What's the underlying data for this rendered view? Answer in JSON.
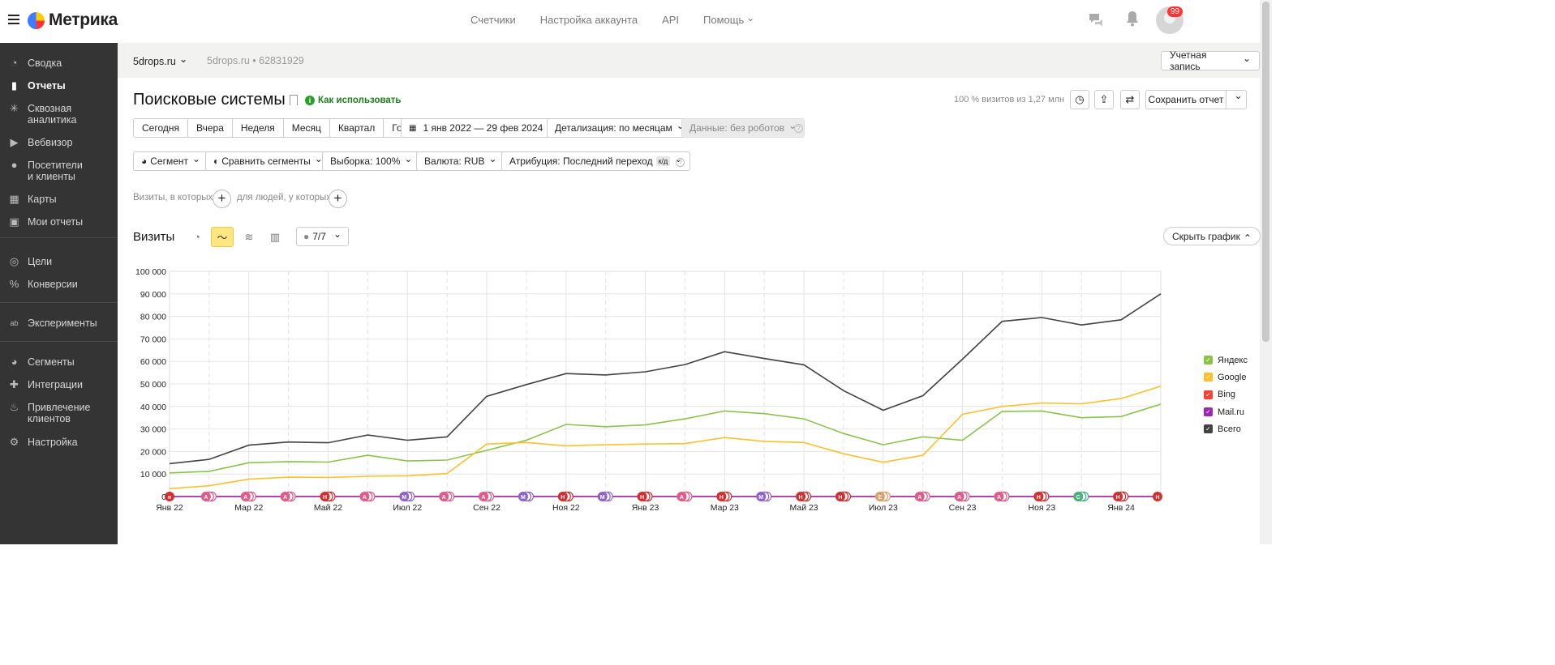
{
  "app": {
    "logo_text": "Метрика",
    "nav": [
      "Счетчики",
      "Настройка аккаунта",
      "API",
      "Помощь"
    ],
    "notifications_badge": "99"
  },
  "sidebar": {
    "items": [
      {
        "label": "Сводка",
        "icon": "gauge-icon"
      },
      {
        "label": "Отчеты",
        "icon": "bar-chart-icon",
        "active": true
      },
      {
        "label": "Сквозная аналитика",
        "icon": "snowflake-icon"
      },
      {
        "label": "Вебвизор",
        "icon": "play-icon"
      },
      {
        "label": "Посетители и клиенты",
        "icon": "user-icon"
      },
      {
        "label": "Карты",
        "icon": "map-icon"
      },
      {
        "label": "Мои отчеты",
        "icon": "inbox-icon"
      },
      {
        "label": "Цели",
        "icon": "target-icon"
      },
      {
        "label": "Конверсии",
        "icon": "percent-icon"
      },
      {
        "label": "Эксперименты",
        "icon": "ab-icon"
      },
      {
        "label": "Сегменты",
        "icon": "pie-icon"
      },
      {
        "label": "Интеграции",
        "icon": "puzzle-icon"
      },
      {
        "label": "Привлечение клиентов",
        "icon": "fire-icon"
      },
      {
        "label": "Настройка",
        "icon": "gear-icon"
      }
    ]
  },
  "subheader": {
    "counter": "5drops.ru",
    "counter_name": "5drops.ru",
    "counter_id": "62831929",
    "account_button": "Учетная запись"
  },
  "report": {
    "title": "Поисковые системы",
    "how_to_use": "Как использовать",
    "visits_share": "100 % визитов из 1,27 млн",
    "save_button": "Сохранить отчет"
  },
  "period_buttons": [
    "Сегодня",
    "Вчера",
    "Неделя",
    "Месяц",
    "Квартал",
    "Год"
  ],
  "date_range": "1 янв 2022 — 29 фев 2024",
  "detail": "Детализация: по месяцам",
  "data_filter": "Данные: без роботов",
  "segment_buttons": {
    "segment": "Сегмент",
    "compare": "Сравнить сегменты",
    "sample": "Выборка: 100%",
    "currency": "Валюта: RUB",
    "attribution": "Атрибуция: Последний переход",
    "attribution_badge": "к/д"
  },
  "filters": {
    "visits_where": "Визиты, в которых",
    "people_where": "для людей, у которых"
  },
  "chart_panel": {
    "title": "Визиты",
    "comments": "7/7",
    "hide_chart": "Скрыть график"
  },
  "colors": {
    "yandex": "#8bc34a",
    "google": "#fbc02d",
    "bing": "#f44336",
    "mailru": "#9c27b0",
    "total": "#424242"
  },
  "chart_data": {
    "type": "line",
    "ylim": [
      0,
      100000
    ],
    "yticks": [
      "0",
      "10 000",
      "20 000",
      "30 000",
      "40 000",
      "50 000",
      "60 000",
      "70 000",
      "80 000",
      "90 000",
      "100 000"
    ],
    "x": [
      "Янв 22",
      "Фев 22",
      "Мар 22",
      "Апр 22",
      "Май 22",
      "Июн 22",
      "Июл 22",
      "Авг 22",
      "Сен 22",
      "Окт 22",
      "Ноя 22",
      "Дек 22",
      "Янв 23",
      "Фев 23",
      "Мар 23",
      "Апр 23",
      "Май 23",
      "Июн 23",
      "Июл 23",
      "Авг 23",
      "Сен 23",
      "Окт 23",
      "Ноя 23",
      "Дек 23",
      "Янв 24",
      "Фев 24"
    ],
    "xtick_labels": [
      "Янв 22",
      "Мар 22",
      "Май 22",
      "Июл 22",
      "Сен 22",
      "Ноя 22",
      "Янв 23",
      "Мар 23",
      "Май 23",
      "Июл 23",
      "Сен 23",
      "Ноя 23",
      "Янв 24"
    ],
    "series": [
      {
        "name": "Яндекс",
        "key": "yandex",
        "values": [
          10500,
          11200,
          15000,
          15500,
          15300,
          18300,
          15800,
          16200,
          20500,
          25000,
          32000,
          31000,
          31800,
          34500,
          38000,
          36800,
          34500,
          28000,
          23000,
          26500,
          25000,
          37800,
          38000,
          35000,
          35500,
          41000
        ]
      },
      {
        "name": "Google",
        "key": "google",
        "values": [
          3500,
          4800,
          7700,
          8600,
          8500,
          9000,
          9200,
          10200,
          23300,
          24000,
          22500,
          23000,
          23300,
          23500,
          26200,
          24500,
          24000,
          19000,
          15200,
          18300,
          36500,
          40000,
          41500,
          41200,
          43500,
          49000
        ]
      },
      {
        "name": "Bing",
        "key": "bing",
        "values": [
          0,
          0,
          0,
          0,
          0,
          0,
          0,
          0,
          0,
          0,
          0,
          0,
          0,
          0,
          0,
          0,
          0,
          0,
          0,
          0,
          0,
          0,
          0,
          0,
          0,
          0
        ]
      },
      {
        "name": "Mail.ru",
        "key": "mailru",
        "values": [
          0,
          0,
          0,
          0,
          0,
          0,
          0,
          0,
          0,
          0,
          0,
          0,
          0,
          0,
          0,
          0,
          0,
          0,
          0,
          0,
          0,
          0,
          0,
          0,
          0,
          0
        ]
      },
      {
        "name": "Всего",
        "key": "total",
        "values": [
          14600,
          16500,
          22800,
          24200,
          23900,
          27300,
          25000,
          26500,
          44500,
          49700,
          54600,
          54000,
          55400,
          58600,
          64300,
          61300,
          58500,
          47000,
          38300,
          44800,
          61000,
          77800,
          79500,
          76200,
          78500,
          90000
        ]
      }
    ],
    "annotation_markers": [
      "н",
      "А",
      "А",
      "А",
      "Н",
      "А",
      "М",
      "А",
      "А",
      "М",
      "Н",
      "М",
      "Н",
      "А",
      "Н",
      "М",
      "Н",
      "Н",
      "Е",
      "А",
      "А",
      "А",
      "Н",
      "С",
      "Н",
      "Н"
    ]
  }
}
